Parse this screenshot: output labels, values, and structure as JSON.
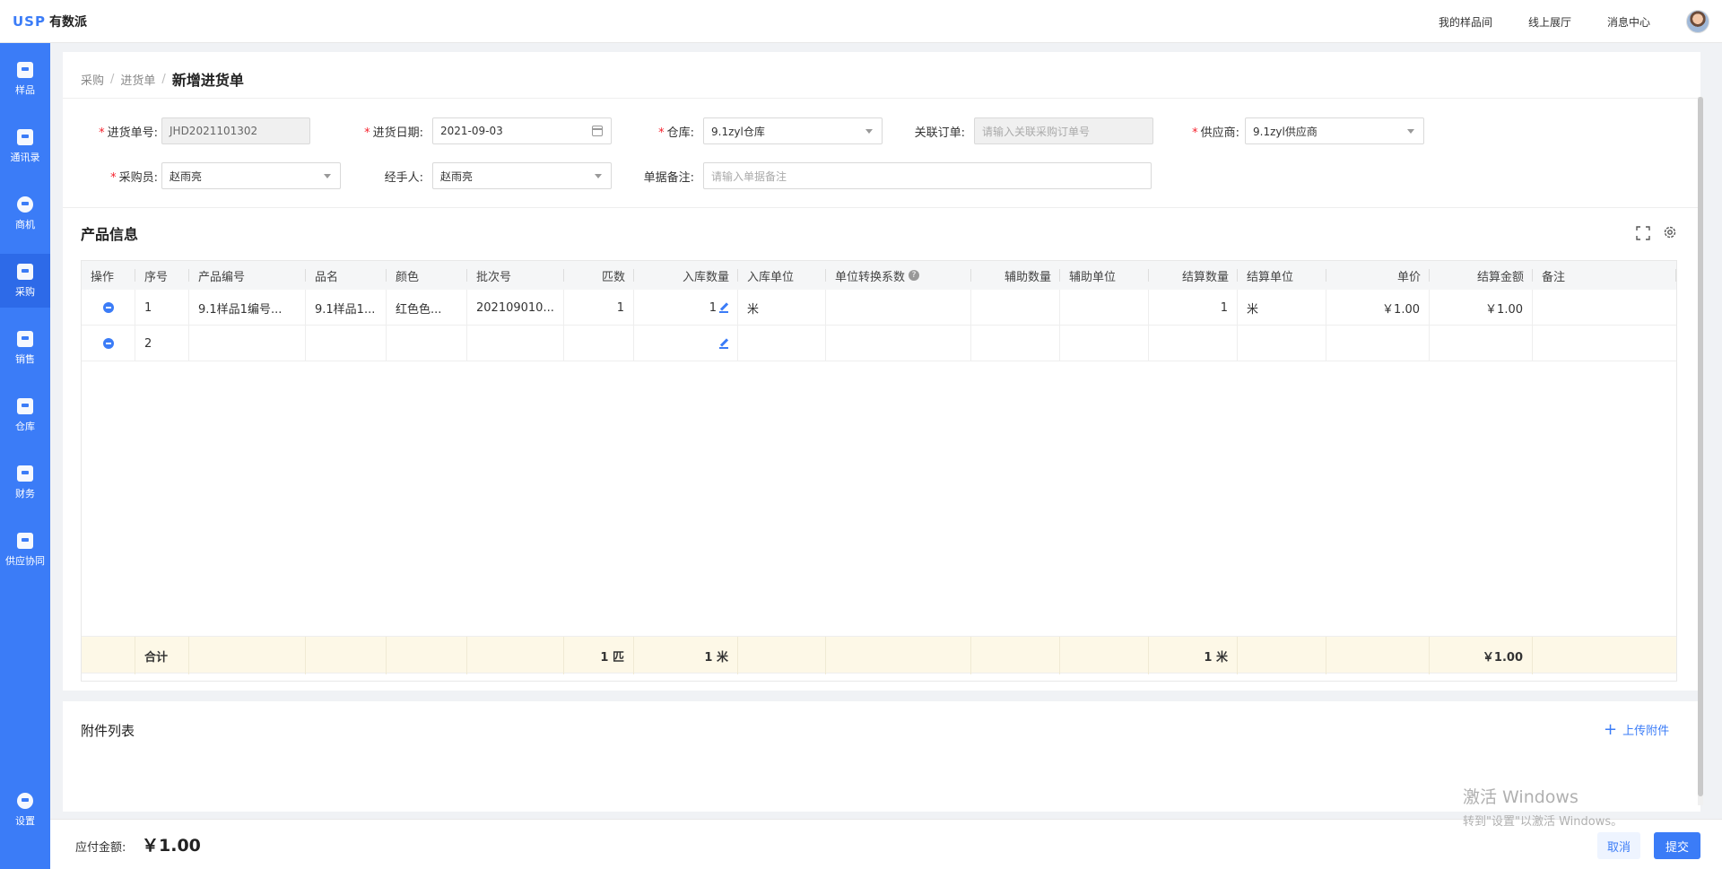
{
  "app": {
    "logo_mark": "USP",
    "logo_text": "有数派"
  },
  "topnav": {
    "items": [
      "我的样品间",
      "线上展厅",
      "消息中心"
    ]
  },
  "sidebar": {
    "items": [
      "样品",
      "通讯录",
      "商机",
      "采购",
      "销售",
      "仓库",
      "财务",
      "供应协同"
    ],
    "active": "采购",
    "settings": "设置"
  },
  "breadcrumb": {
    "items": [
      "采购",
      "进货单"
    ],
    "current": "新增进货单"
  },
  "form": {
    "order_no": {
      "label": "进货单号:",
      "value": "JHD2021101302"
    },
    "date": {
      "label": "进货日期:",
      "value": "2021-09-03"
    },
    "warehouse": {
      "label": "仓库:",
      "value": "9.1zyl仓库"
    },
    "related_order": {
      "label": "关联订单:",
      "placeholder": "请输入关联采购订单号"
    },
    "supplier": {
      "label": "供应商:",
      "value": "9.1zyl供应商"
    },
    "buyer": {
      "label": "采购员:",
      "value": "赵雨亮"
    },
    "handler": {
      "label": "经手人:",
      "value": "赵雨亮"
    },
    "remark": {
      "label": "单据备注:",
      "placeholder": "请输入单据备注"
    }
  },
  "products": {
    "title": "产品信息",
    "columns": [
      "操作",
      "序号",
      "产品编号",
      "品名",
      "颜色",
      "批次号",
      "匹数",
      "入库数量",
      "入库单位",
      "单位转换系数",
      "辅助数量",
      "辅助单位",
      "结算数量",
      "结算单位",
      "单价",
      "结算金额",
      "备注"
    ],
    "rows": [
      {
        "seq": "1",
        "code": "9.1样品1编号...",
        "name": "9.1样品1...",
        "color": "红色色...",
        "batch": "202109010...",
        "pieces": "1",
        "qty": "1",
        "unit": "米",
        "factor": "",
        "aux_qty": "",
        "aux_unit": "",
        "settle_qty": "1",
        "settle_unit": "米",
        "price": "￥1.00",
        "amount": "￥1.00",
        "note": ""
      },
      {
        "seq": "2",
        "code": "",
        "name": "",
        "color": "",
        "batch": "",
        "pieces": "",
        "qty": "",
        "unit": "",
        "factor": "",
        "aux_qty": "",
        "aux_unit": "",
        "settle_qty": "",
        "settle_unit": "",
        "price": "",
        "amount": "",
        "note": ""
      }
    ],
    "total": {
      "label": "合计",
      "pieces": "1 匹",
      "qty": "1 米",
      "settle_qty": "1 米",
      "amount": "￥1.00"
    }
  },
  "attachments": {
    "title": "附件列表",
    "upload": "上传附件"
  },
  "footer": {
    "payable_label": "应付金额:",
    "payable_value": "￥1.00",
    "cancel": "取消",
    "submit": "提交"
  },
  "watermark": {
    "line1": "激活 Windows",
    "line2": "转到\"设置\"以激活 Windows。"
  },
  "colors": {
    "primary": "#3b7cf7",
    "total_row_bg": "#fdf8e7",
    "required": "#f5222d"
  }
}
